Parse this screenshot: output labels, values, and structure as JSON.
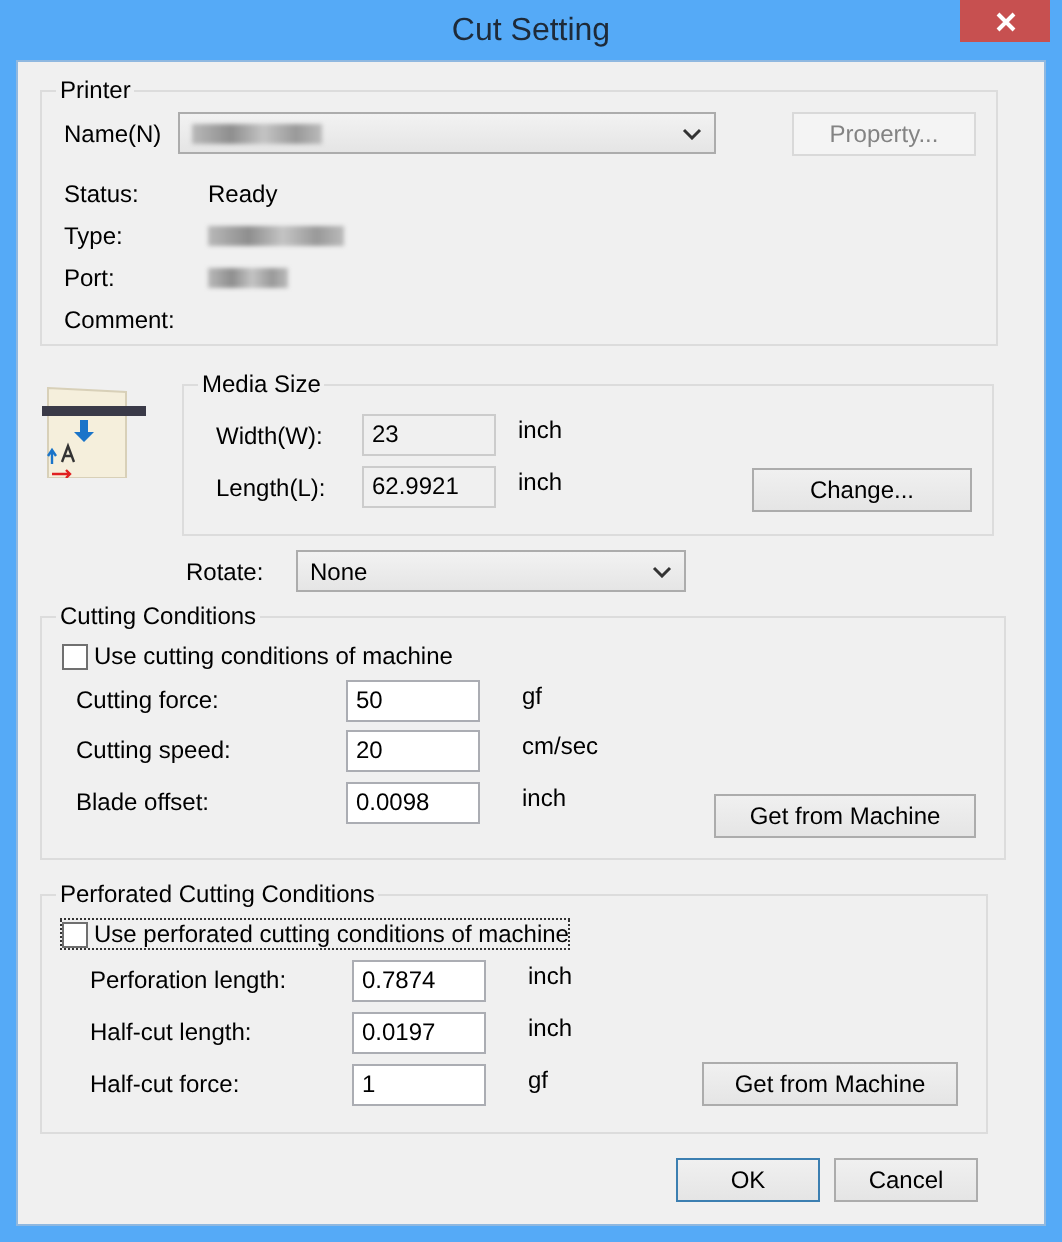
{
  "window": {
    "title": "Cut Setting"
  },
  "printer": {
    "legend": "Printer",
    "name_label": "Name(N)",
    "name_field": {
      "blurred": true
    },
    "property_button": {
      "label": "Property...",
      "disabled": true
    },
    "info": [
      {
        "label": "Status:",
        "kind": "text",
        "value": "Ready"
      },
      {
        "label": "Type:",
        "kind": "blurred"
      },
      {
        "label": "Port:",
        "kind": "blurred"
      },
      {
        "label": "Comment:",
        "kind": "empty"
      }
    ]
  },
  "media_size": {
    "legend": "Media Size",
    "fields": [
      {
        "label": "Width(W):",
        "value": "23",
        "unit": "inch",
        "readonly": true
      },
      {
        "label": "Length(L):",
        "value": "62.9921",
        "unit": "inch",
        "readonly": true
      }
    ],
    "change_button": {
      "label": "Change..."
    },
    "rotate": {
      "label": "Rotate:",
      "value": "None"
    }
  },
  "cutting_conditions": {
    "legend": "Cutting Conditions",
    "checkbox": {
      "label": "Use cutting conditions of machine",
      "checked": false,
      "focused": false
    },
    "fields": [
      {
        "label": "Cutting force:",
        "value": "50",
        "unit": "gf",
        "readonly": false
      },
      {
        "label": "Cutting speed:",
        "value": "20",
        "unit": "cm/sec",
        "readonly": false
      },
      {
        "label": "Blade offset:",
        "value": "0.0098",
        "unit": "inch",
        "readonly": false
      }
    ],
    "button": {
      "label": "Get from Machine"
    }
  },
  "perforated_cutting_conditions": {
    "legend": "Perforated Cutting Conditions",
    "checkbox": {
      "label": "Use perforated cutting conditions of machine",
      "checked": false,
      "focused": true
    },
    "fields": [
      {
        "label": "Perforation length:",
        "value": "0.7874",
        "unit": "inch",
        "readonly": false
      },
      {
        "label": "Half-cut length:",
        "value": "0.0197",
        "unit": "inch",
        "readonly": false
      },
      {
        "label": "Half-cut force:",
        "value": "1",
        "unit": "gf",
        "readonly": false
      }
    ],
    "button": {
      "label": "Get from Machine"
    }
  },
  "buttons": [
    {
      "label": "OK",
      "default": true
    },
    {
      "label": "Cancel",
      "default": false
    }
  ]
}
